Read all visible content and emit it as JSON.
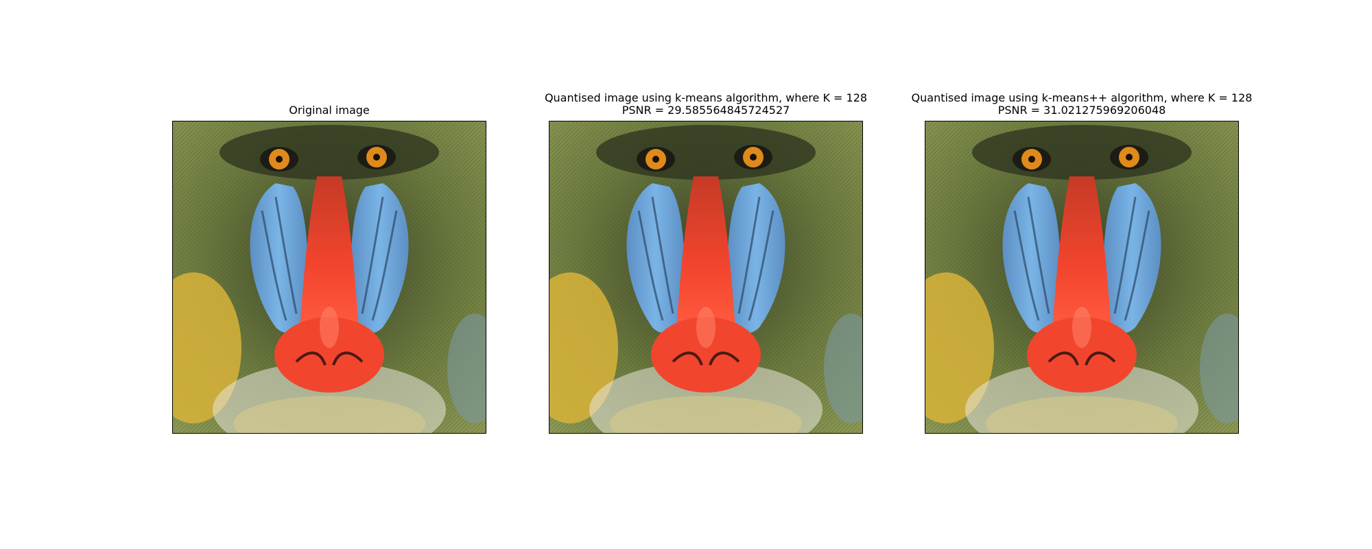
{
  "figure": {
    "panels": [
      {
        "title": "Original image",
        "subtitle": ""
      },
      {
        "title": "Quantised image using k-means algorithm, where K = 128",
        "subtitle": "PSNR = 29.585564845724527"
      },
      {
        "title": "Quantised image using k-means++ algorithm, where K = 128",
        "subtitle": "PSNR = 31.021275969206048"
      }
    ],
    "image_subject": "mandrill-face",
    "colors": {
      "fur_green": "#6b7a3e",
      "fur_dark": "#3a4226",
      "fur_yellow": "#d8b33a",
      "cheek_blue": "#7ab4e6",
      "nose_red": "#f2452e",
      "eye_orange": "#e08a1c",
      "whisker_white": "#e8e6dc"
    }
  }
}
